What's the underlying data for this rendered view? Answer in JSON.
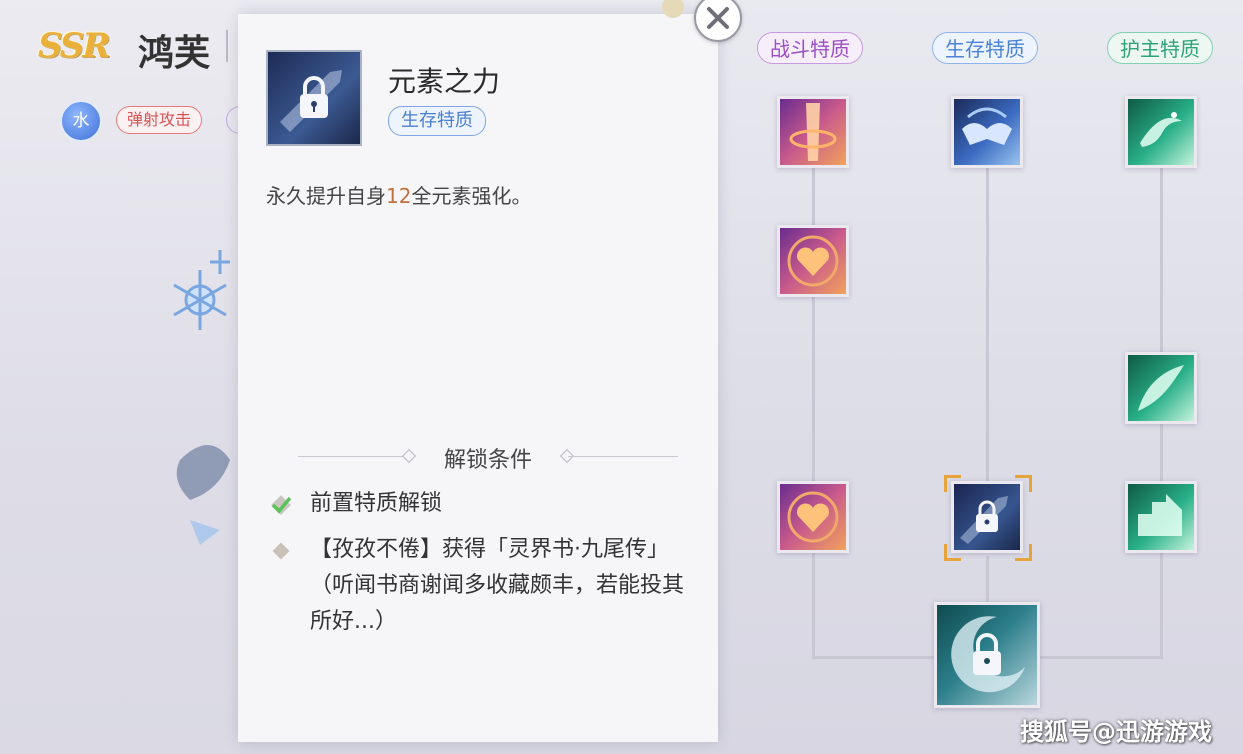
{
  "character": {
    "rarity": "SSR",
    "name": "鸿芙",
    "element": "水",
    "tag": "弹射攻击"
  },
  "popup": {
    "skill_name": "元素之力",
    "skill_type": "生存特质",
    "description_prefix": "永久提升自身",
    "description_value": "12",
    "description_suffix": "全元素强化。",
    "unlock_header": "解锁条件",
    "conditions": [
      {
        "text": "前置特质解锁",
        "status": "done"
      },
      {
        "text": "【孜孜不倦】获得「灵界书·九尾传」（听闻书商谢闻多收藏颇丰，若能投其所好...）",
        "status": "pending"
      }
    ]
  },
  "tree": {
    "columns": [
      {
        "label": "战斗特质",
        "color": "#9b4fc3"
      },
      {
        "label": "生存特质",
        "color": "#4a82d6"
      },
      {
        "label": "护主特质",
        "color": "#2ea27b"
      }
    ],
    "nodes": {
      "combat": [
        "flame-pillar-icon",
        "heart-icon",
        "heart-icon"
      ],
      "survive": [
        "bat-wing-icon",
        "locked-sword-icon"
      ],
      "guard": [
        "swirl-icon",
        "feather-icon",
        "shield-step-icon"
      ],
      "final": "locked-moon-icon"
    }
  },
  "watermark": "搜狐号@迅游游戏"
}
